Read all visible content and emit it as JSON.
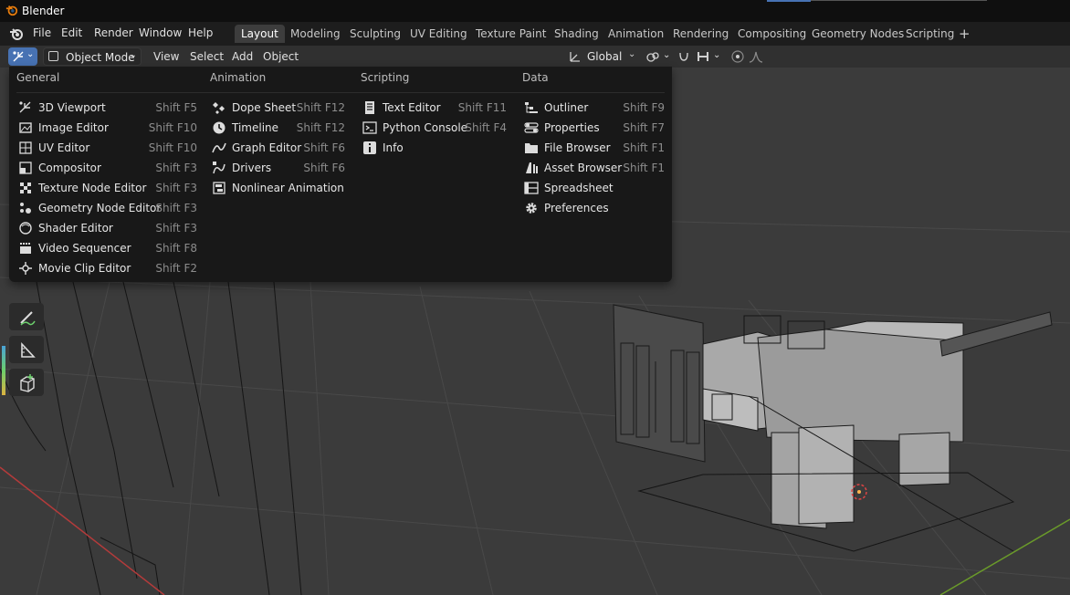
{
  "window": {
    "title": "Blender",
    "accent_color": "#4772b3"
  },
  "top_menu": {
    "file": "File",
    "edit": "Edit",
    "render": "Render",
    "window": "Window",
    "help": "Help"
  },
  "workspaces": [
    {
      "label": "Layout",
      "active": true
    },
    {
      "label": "Modeling"
    },
    {
      "label": "Sculpting"
    },
    {
      "label": "UV Editing"
    },
    {
      "label": "Texture Paint"
    },
    {
      "label": "Shading"
    },
    {
      "label": "Animation"
    },
    {
      "label": "Rendering"
    },
    {
      "label": "Compositing"
    },
    {
      "label": "Geometry Nodes"
    },
    {
      "label": "Scripting"
    }
  ],
  "workspace_add_icon": "plus-icon",
  "header": {
    "mode": "Object Mode",
    "view": "View",
    "select": "Select",
    "add": "Add",
    "object": "Object",
    "orientation": "Global"
  },
  "editor_type_menu": {
    "columns": [
      {
        "title": "General",
        "items": [
          {
            "label": "3D Viewport",
            "shortcut": "Shift F5",
            "icon": "viewport-3d-icon"
          },
          {
            "label": "Image Editor",
            "shortcut": "Shift F10",
            "icon": "image-editor-icon"
          },
          {
            "label": "UV Editor",
            "shortcut": "Shift F10",
            "icon": "uv-editor-icon"
          },
          {
            "label": "Compositor",
            "shortcut": "Shift F3",
            "icon": "compositor-icon"
          },
          {
            "label": "Texture Node Editor",
            "shortcut": "Shift F3",
            "icon": "texture-node-icon"
          },
          {
            "label": "Geometry Node Editor",
            "shortcut": "Shift F3",
            "icon": "geometry-node-icon"
          },
          {
            "label": "Shader Editor",
            "shortcut": "Shift F3",
            "icon": "shader-editor-icon"
          },
          {
            "label": "Video Sequencer",
            "shortcut": "Shift F8",
            "icon": "video-sequencer-icon"
          },
          {
            "label": "Movie Clip Editor",
            "shortcut": "Shift F2",
            "icon": "movie-clip-icon"
          }
        ]
      },
      {
        "title": "Animation",
        "items": [
          {
            "label": "Dope Sheet",
            "shortcut": "Shift F12",
            "icon": "dope-sheet-icon"
          },
          {
            "label": "Timeline",
            "shortcut": "Shift F12",
            "icon": "timeline-icon"
          },
          {
            "label": "Graph Editor",
            "shortcut": "Shift F6",
            "icon": "graph-editor-icon"
          },
          {
            "label": "Drivers",
            "shortcut": "Shift F6",
            "icon": "drivers-icon"
          },
          {
            "label": "Nonlinear Animation",
            "shortcut": "",
            "icon": "nla-icon"
          }
        ]
      },
      {
        "title": "Scripting",
        "items": [
          {
            "label": "Text Editor",
            "shortcut": "Shift F11",
            "icon": "text-editor-icon"
          },
          {
            "label": "Python Console",
            "shortcut": "Shift F4",
            "icon": "python-console-icon"
          },
          {
            "label": "Info",
            "shortcut": "",
            "icon": "info-icon"
          }
        ]
      },
      {
        "title": "Data",
        "items": [
          {
            "label": "Outliner",
            "shortcut": "Shift F9",
            "icon": "outliner-icon"
          },
          {
            "label": "Properties",
            "shortcut": "Shift F7",
            "icon": "properties-icon"
          },
          {
            "label": "File Browser",
            "shortcut": "Shift F1",
            "icon": "file-browser-icon"
          },
          {
            "label": "Asset Browser",
            "shortcut": "Shift F1",
            "icon": "asset-browser-icon"
          },
          {
            "label": "Spreadsheet",
            "shortcut": "",
            "icon": "spreadsheet-icon"
          },
          {
            "label": "Preferences",
            "shortcut": "",
            "icon": "preferences-icon"
          }
        ]
      }
    ]
  },
  "toolbar_icons": [
    "annotate-icon",
    "measure-icon",
    "add-cube-icon"
  ]
}
